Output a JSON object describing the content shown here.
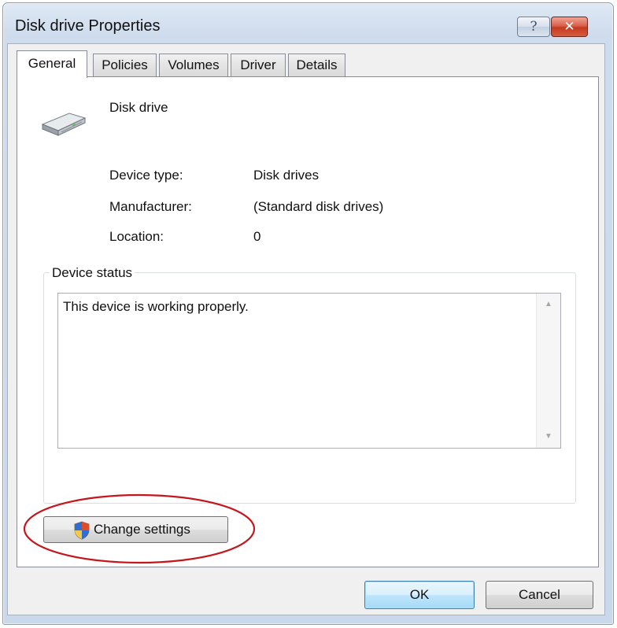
{
  "window": {
    "title": "Disk drive Properties",
    "help_label": "?",
    "close_label": "✕"
  },
  "tabs": [
    {
      "label": "General",
      "active": true
    },
    {
      "label": "Policies",
      "active": false
    },
    {
      "label": "Volumes",
      "active": false
    },
    {
      "label": "Driver",
      "active": false
    },
    {
      "label": "Details",
      "active": false
    }
  ],
  "device": {
    "name": "Disk drive",
    "icon": "disk-drive-icon",
    "properties": [
      {
        "label": "Device type:",
        "value": "Disk drives"
      },
      {
        "label": "Manufacturer:",
        "value": "(Standard disk drives)"
      },
      {
        "label": "Location:",
        "value": "0"
      }
    ]
  },
  "status": {
    "legend": "Device status",
    "text": "This device is working properly."
  },
  "change_settings": {
    "label": "Change settings",
    "icon": "uac-shield-icon"
  },
  "footer": {
    "ok_label": "OK",
    "cancel_label": "Cancel"
  },
  "colors": {
    "annotation": "#c4161c",
    "ok_border": "#3c7fb1",
    "close_button": "#c6391f"
  }
}
